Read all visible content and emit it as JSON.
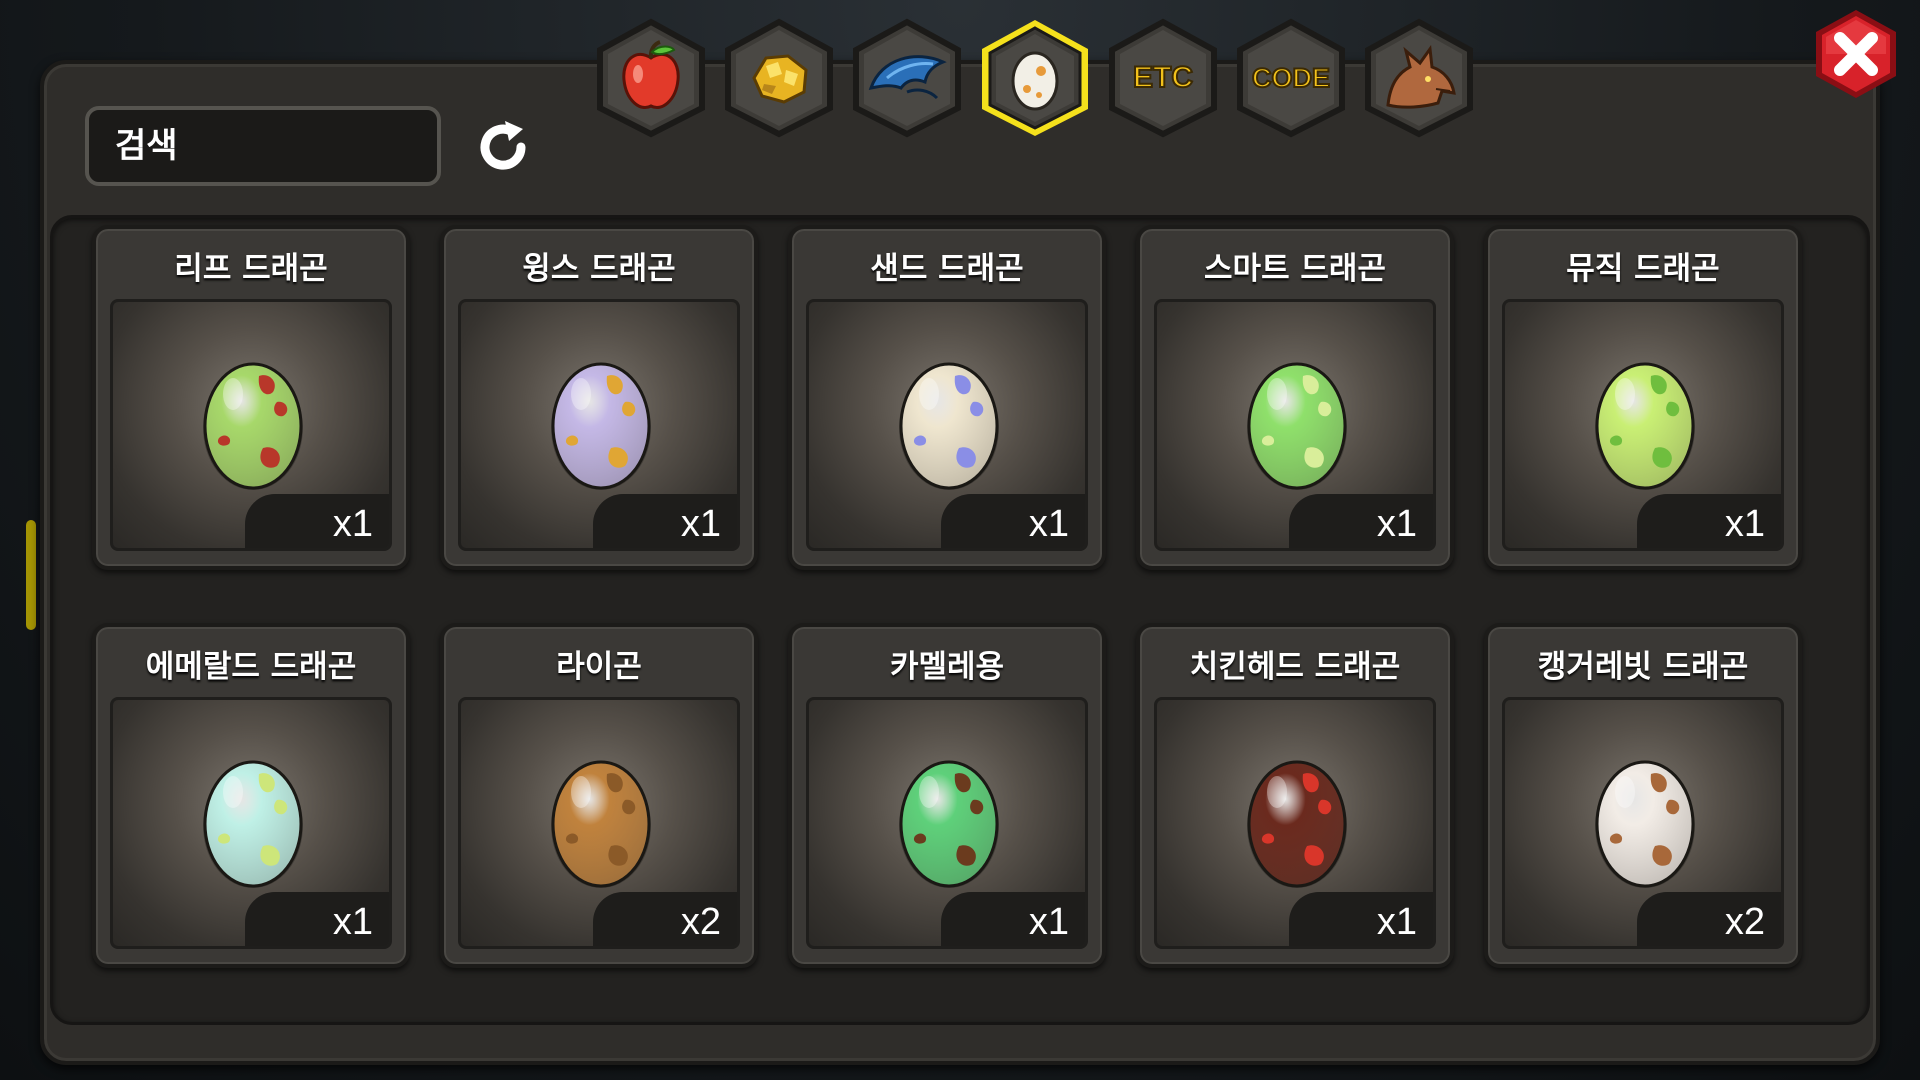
{
  "search": {
    "placeholder": "검색",
    "value": ""
  },
  "tabs": [
    {
      "name": "fruit",
      "label": "",
      "selected": false
    },
    {
      "name": "gold",
      "label": "",
      "selected": false
    },
    {
      "name": "wing",
      "label": "",
      "selected": false
    },
    {
      "name": "egg",
      "label": "",
      "selected": true
    },
    {
      "name": "etc",
      "label": "ETC",
      "selected": false
    },
    {
      "name": "code",
      "label": "CODE",
      "selected": false
    },
    {
      "name": "dragon",
      "label": "",
      "selected": false
    }
  ],
  "items": [
    {
      "name": "리프 드래곤",
      "count": "x1",
      "egg_base": "#a7d86a",
      "egg_spot": "#b8372a"
    },
    {
      "name": "윙스 드래곤",
      "count": "x1",
      "egg_base": "#c4b8e6",
      "egg_spot": "#e0a634"
    },
    {
      "name": "샌드 드래곤",
      "count": "x1",
      "egg_base": "#efe6cf",
      "egg_spot": "#8a8ee6"
    },
    {
      "name": "스마트 드래곤",
      "count": "x1",
      "egg_base": "#8fe06b",
      "egg_spot": "#d9ee9a"
    },
    {
      "name": "뮤직 드래곤",
      "count": "x1",
      "egg_base": "#c9ef74",
      "egg_spot": "#6fbe3e"
    },
    {
      "name": "에메랄드 드래곤",
      "count": "x1",
      "egg_base": "#bff0e6",
      "egg_spot": "#cde67a"
    },
    {
      "name": "라이곤",
      "count": "x2",
      "egg_base": "#c0823d",
      "egg_spot": "#8b5a28"
    },
    {
      "name": "카멜레용",
      "count": "x1",
      "egg_base": "#5ed07a",
      "egg_spot": "#6b3b1e"
    },
    {
      "name": "치킨헤드 드래곤",
      "count": "x1",
      "egg_base": "#6b2a1e",
      "egg_spot": "#d9362a"
    },
    {
      "name": "캥거레빗 드래곤",
      "count": "x2",
      "egg_base": "#f2ece6",
      "egg_spot": "#a8683a"
    }
  ],
  "colors": {
    "accent_selected": "#f5e11c",
    "close_red": "#d8222a"
  }
}
